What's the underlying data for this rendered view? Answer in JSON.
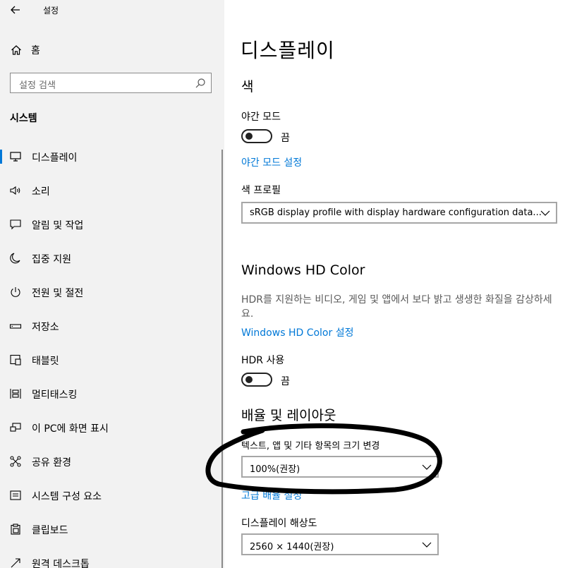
{
  "app": {
    "title": "설정"
  },
  "sidebar": {
    "home_label": "홈",
    "search_placeholder": "설정 검색",
    "section_label": "시스템",
    "items": [
      {
        "label": "디스플레이",
        "icon": "monitor-icon",
        "active": true
      },
      {
        "label": "소리",
        "icon": "speaker-icon"
      },
      {
        "label": "알림 및 작업",
        "icon": "message-icon"
      },
      {
        "label": "집중 지원",
        "icon": "moon-icon"
      },
      {
        "label": "전원 및 절전",
        "icon": "power-icon"
      },
      {
        "label": "저장소",
        "icon": "storage-icon"
      },
      {
        "label": "태블릿",
        "icon": "tablet-icon"
      },
      {
        "label": "멀티태스킹",
        "icon": "multitask-icon"
      },
      {
        "label": "이 PC에 화면 표시",
        "icon": "project-icon"
      },
      {
        "label": "공유 환경",
        "icon": "share-icon"
      },
      {
        "label": "시스템 구성 요소",
        "icon": "components-icon"
      },
      {
        "label": "클립보드",
        "icon": "clipboard-icon"
      },
      {
        "label": "원격 데스크톱",
        "icon": "remote-icon"
      }
    ]
  },
  "main": {
    "title": "디스플레이",
    "color_section": {
      "heading": "색",
      "night_mode_label": "야간 모드",
      "night_mode_state": "끔",
      "night_mode_link": "야간 모드 설정",
      "profile_label": "색 프로필",
      "profile_value": "sRGB display profile with display hardware configuration data..."
    },
    "hd_color_section": {
      "heading": "Windows HD Color",
      "description": "HDR를 지원하는 비디오, 게임 및 앱에서 보다 밝고 생생한 화질을 감상하세요.",
      "link": "Windows HD Color 설정",
      "hdr_label": "HDR 사용",
      "hdr_state": "끔"
    },
    "scale_section": {
      "heading": "배율 및 레이아웃",
      "scale_label": "텍스트, 앱 및 기타 항목의 크기 변경",
      "scale_value": "100%(권장)",
      "advanced_link": "고급 배율 설정",
      "resolution_label": "디스플레이 해상도",
      "resolution_value": "2560 × 1440(권장)"
    }
  },
  "colors": {
    "accent": "#0078d7",
    "sidebar_bg": "#f2f2f2",
    "annotation": "#000000"
  }
}
